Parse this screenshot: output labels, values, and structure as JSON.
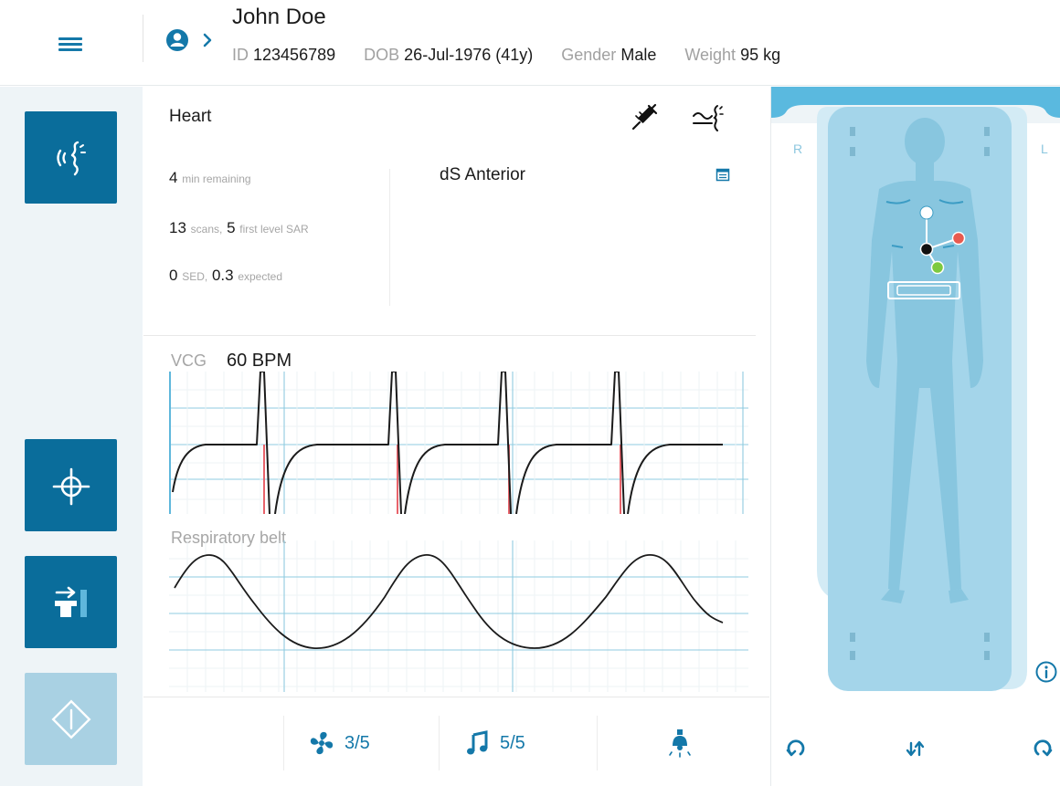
{
  "patient": {
    "name": "John Doe",
    "id_label": "ID",
    "id_value": "123456789",
    "dob_label": "DOB",
    "dob_value": "26-Jul-1976 (41y)",
    "gender_label": "Gender",
    "gender_value": "Male",
    "weight_label": "Weight",
    "weight_value": "95",
    "weight_unit": "kg"
  },
  "protocol": {
    "title": "Heart",
    "scan_name": "dS Anterior",
    "minutes_value": "4",
    "minutes_text": "min remaining",
    "scans_value": "13",
    "scans_text": "scans,",
    "sar_value": "5",
    "sar_text": "first level SAR",
    "sed_value": "0",
    "sed_text": "SED,",
    "expected_value": "0.3",
    "expected_text": "expected"
  },
  "vcg": {
    "label": "VCG",
    "bpm": "60 BPM"
  },
  "respiratory": {
    "label": "Respiratory belt"
  },
  "toolbar": {
    "fan_value": "3/5",
    "music_value": "5/5"
  },
  "body_map": {
    "right_label": "R",
    "left_label": "L"
  },
  "colors": {
    "accent": "#0a6d9b",
    "accent_light": "#a9d1e3",
    "trace_grid": "#7fc7de",
    "trigger_marker": "#e8636b",
    "electrode_red": "#e85a4f",
    "electrode_green": "#7dc93f"
  },
  "icons": {
    "menu": "hamburger-icon",
    "patient": "patient-icon",
    "voice": "voice-guidance-icon",
    "target": "crosshair-target-icon",
    "table": "table-move-icon",
    "start": "start-scan-icon",
    "injector": "injector-icon",
    "breath": "breath-hold-icon",
    "calendar": "calendar-icon",
    "fan": "fan-icon",
    "music": "music-icon",
    "light": "light-icon",
    "info": "info-icon",
    "rotate_left": "rotate-left-icon",
    "table_up_down": "table-up-down-icon",
    "rotate_right": "rotate-right-icon"
  }
}
